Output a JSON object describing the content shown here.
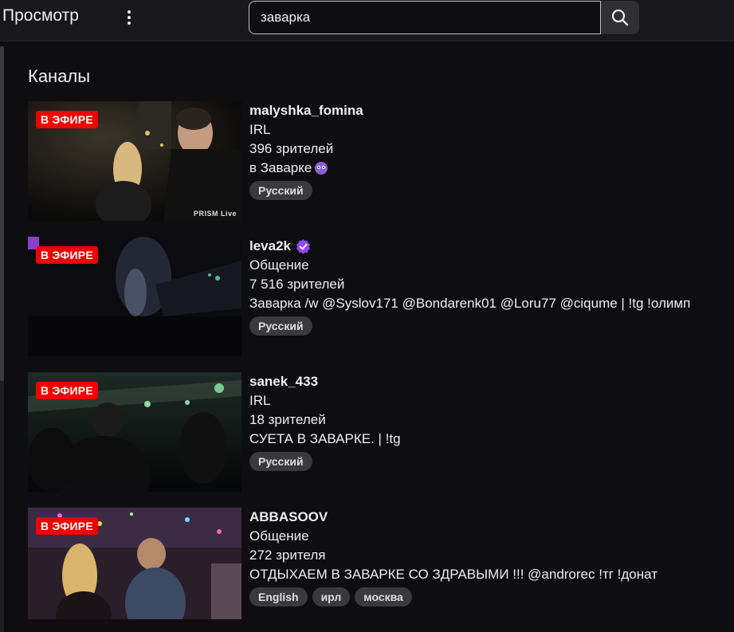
{
  "header": {
    "title": "Просмотр",
    "search_value": "заварка"
  },
  "section": {
    "title": "Каналы"
  },
  "badges": {
    "live": "В ЭФИРЕ"
  },
  "channels": [
    {
      "name": "malyshka_fomina",
      "verified": false,
      "category": "IRL",
      "viewers": "396 зрителей",
      "title": "в Заварке",
      "emote": "purple-face-emote",
      "tags": [
        "Русский"
      ],
      "watermark": "PRISM Live"
    },
    {
      "name": "leva2k",
      "verified": true,
      "category": "Общение",
      "viewers": "7 516 зрителей",
      "title": "Заварка /w @Syslov171 @Bondarenk01 @Loru77 @ciqume | !tg !олимп",
      "tags": [
        "Русский"
      ]
    },
    {
      "name": "sanek_433",
      "verified": false,
      "category": "IRL",
      "viewers": "18 зрителей",
      "title": "СУЕТА В ЗАВАРКЕ. | !tg",
      "tags": [
        "Русский"
      ]
    },
    {
      "name": "ABBASOOV",
      "verified": false,
      "category": "Общение",
      "viewers": "272 зрителя",
      "title": "ОТДЫХАЕМ В ЗАВАРКЕ СО ЗДРАВЫМИ !!! @androrec !тг !донат",
      "tags": [
        "English",
        "ирл",
        "москва"
      ]
    }
  ],
  "colors": {
    "live_badge": "#eb0400",
    "verified": "#9147ff",
    "background": "#0e0e10"
  }
}
